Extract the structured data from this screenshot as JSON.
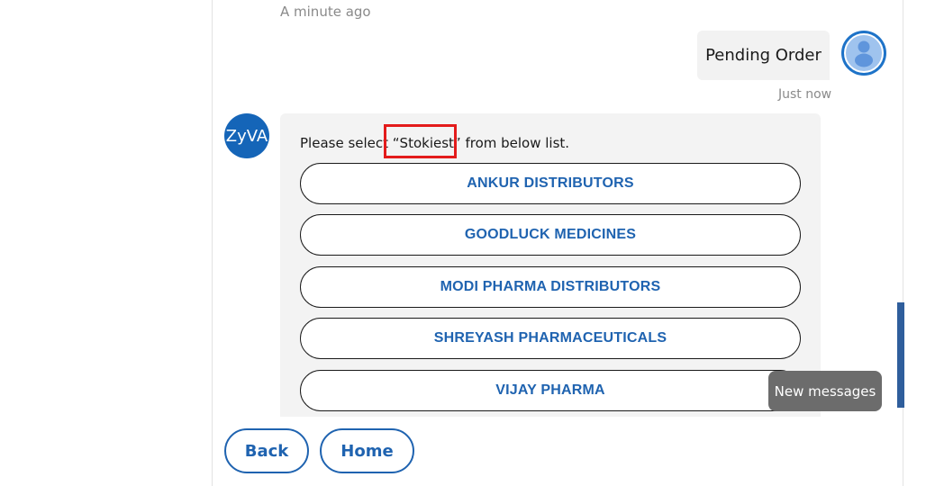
{
  "conversation": {
    "previous_timestamp": "A minute ago",
    "user_message": {
      "text": "Pending Order",
      "timestamp": "Just now",
      "avatar_icon": "user-avatar-icon"
    },
    "bot_message": {
      "avatar_label": "ZyVA",
      "prompt": "Please select “Stokiest” from below list.",
      "highlighted_term": "“Stokiest”",
      "options": [
        "ANKUR DISTRIBUTORS",
        "GOODLUCK MEDICINES",
        "MODI PHARMA DISTRIBUTORS",
        "SHREYASH PHARMACEUTICALS",
        "VIJAY PHARMA"
      ]
    }
  },
  "toast": {
    "label": "New messages"
  },
  "footer": {
    "back_label": "Back",
    "home_label": "Home"
  },
  "colors": {
    "accent": "#1f63b0",
    "bot_avatar": "#1565b8",
    "highlight": "#e31b1b",
    "toast_bg": "#6c6c6c",
    "bubble_bg": "#f2f2f2"
  }
}
